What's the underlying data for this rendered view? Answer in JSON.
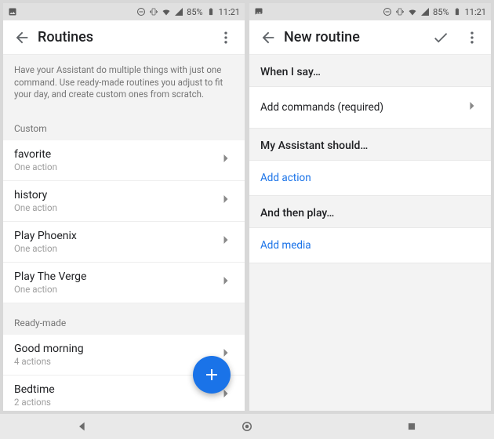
{
  "status": {
    "battery": "85%",
    "time": "11:21"
  },
  "left": {
    "title": "Routines",
    "intro": "Have your Assistant do multiple things with just one command. Use ready-made routines you adjust to fit your day, and create custom ones from scratch.",
    "section_custom": "Custom",
    "section_ready": "Ready-made",
    "custom": [
      {
        "name": "favorite",
        "sub": "One action"
      },
      {
        "name": "history",
        "sub": "One action"
      },
      {
        "name": "Play Phoenix",
        "sub": "One action"
      },
      {
        "name": "Play The Verge",
        "sub": "One action"
      }
    ],
    "ready": [
      {
        "name": "Good morning",
        "sub": "4 actions"
      },
      {
        "name": "Bedtime",
        "sub": "2 actions"
      }
    ]
  },
  "right": {
    "title": "New routine",
    "when": "When I say…",
    "add_commands": "Add commands (required)",
    "should": "My Assistant should…",
    "add_action": "Add action",
    "then_play": "And then play…",
    "add_media": "Add media"
  }
}
